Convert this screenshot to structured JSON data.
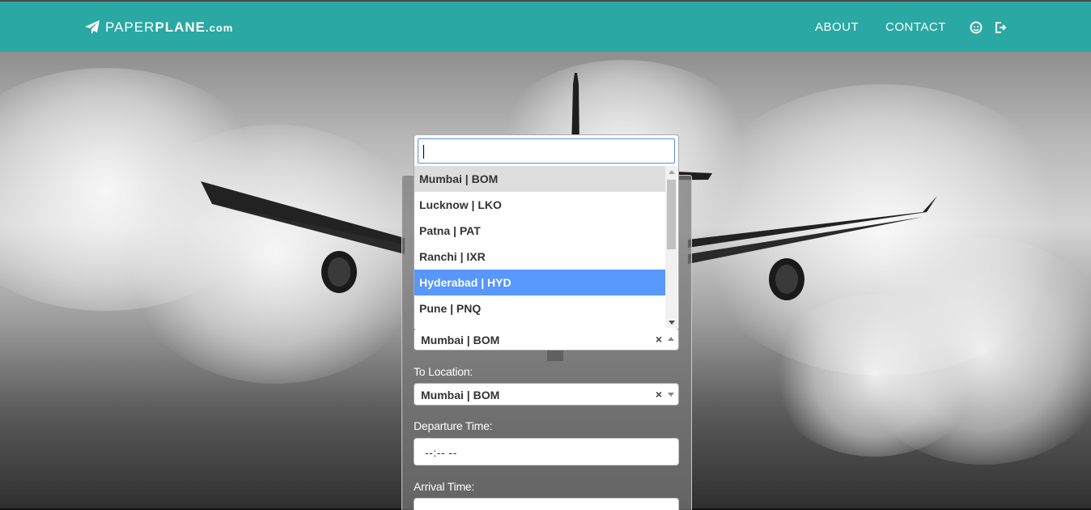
{
  "brand": {
    "light": "PAPER",
    "bold": "PLANE",
    "suffix": ".com",
    "icon": "paper-plane-icon"
  },
  "nav": {
    "about": "ABOUT",
    "contact": "CONTACT",
    "icons": [
      "user-smile-icon",
      "logout-icon"
    ]
  },
  "colors": {
    "header": "#2aa8a3",
    "highlight": "#5897fb",
    "current": "#dddddd"
  },
  "dropdown": {
    "search_value": "",
    "options": [
      "Mumbai | BOM",
      "Lucknow | LKO",
      "Patna | PAT",
      "Ranchi | IXR",
      "Hyderabad | HYD",
      "Pune | PNQ"
    ],
    "current_option": "Mumbai | BOM",
    "highlighted_option": "Hyderabad | HYD"
  },
  "form": {
    "from": {
      "value": "Mumbai | BOM",
      "clear": "×"
    },
    "to_label": "To Location:",
    "to": {
      "value": "Mumbai | BOM",
      "clear": "×"
    },
    "departure_label": "Departure Time:",
    "departure_value": "--:-- --",
    "arrival_label": "Arrival Time:",
    "arrival_value": ""
  }
}
